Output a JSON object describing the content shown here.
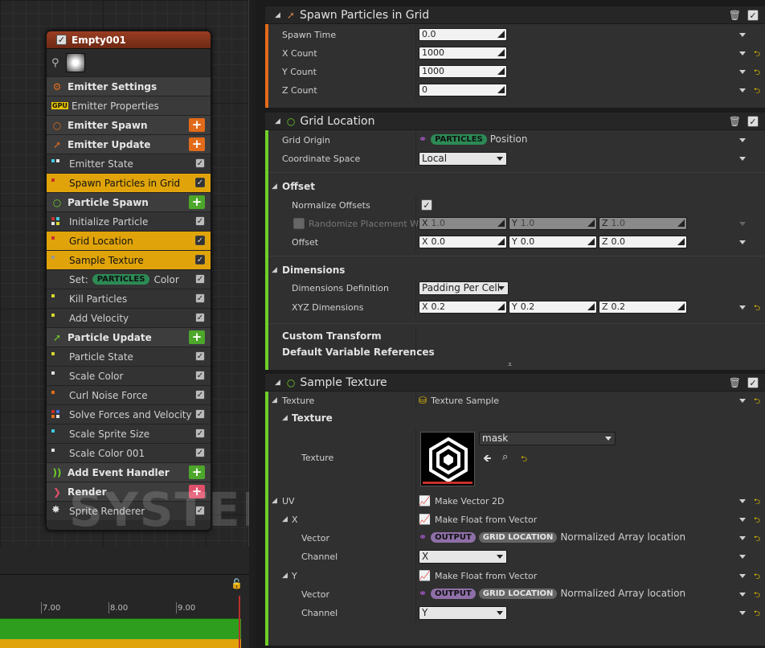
{
  "graph": {
    "watermark": "SYSTEM",
    "node": {
      "title": "Empty001",
      "rows": [
        {
          "kind": "hdr",
          "label": "Emitter Settings",
          "icon": "⚙",
          "icon_color": "#e26b1a",
          "icon_name": "emitter-settings-icon"
        },
        {
          "kind": "props",
          "label": "Emitter Properties",
          "icon": "GPU",
          "icon_name": "gpu-icon"
        },
        {
          "kind": "hdr",
          "label": "Emitter Spawn",
          "icon": "○",
          "icon_color": "#e26b1a",
          "icon_name": "emitter-spawn-icon",
          "plus": "o"
        },
        {
          "kind": "hdr",
          "label": "Emitter Update",
          "icon": "➚",
          "icon_color": "#e26b1a",
          "icon_name": "emitter-update-icon",
          "plus": "o"
        },
        {
          "kind": "mod",
          "label": "Emitter State",
          "dots": [
            "#3fc9e0",
            "#e0e0e0"
          ]
        },
        {
          "kind": "mod",
          "label": "Spawn Particles in Grid",
          "selected": true,
          "dots": [
            "#c8302a"
          ]
        },
        {
          "kind": "hdr",
          "label": "Particle Spawn",
          "icon": "○",
          "icon_color": "#6fcf2a",
          "icon_name": "particle-spawn-icon",
          "plus": "g"
        },
        {
          "kind": "mod",
          "label": "Initialize Particle",
          "dots": [
            "#c8302a",
            "#3fc9e0",
            "#e0e0e0",
            "#d6d630"
          ]
        },
        {
          "kind": "mod",
          "label": "Grid Location",
          "selected": true,
          "dots": [
            "#c8302a"
          ]
        },
        {
          "kind": "mod",
          "label": "Sample Texture",
          "selected": true,
          "dots": [
            "#999"
          ]
        },
        {
          "kind": "mod",
          "label": "Set:",
          "pill": "PARTICLES",
          "suffix": "Color",
          "dots": []
        },
        {
          "kind": "mod",
          "label": "Kill Particles",
          "dots": [
            "#d6d630"
          ]
        },
        {
          "kind": "mod",
          "label": "Add Velocity",
          "dots": [
            "#d6d630"
          ]
        },
        {
          "kind": "hdr",
          "label": "Particle Update",
          "icon": "➚",
          "icon_color": "#6fcf2a",
          "icon_name": "particle-update-icon",
          "plus": "g"
        },
        {
          "kind": "mod",
          "label": "Particle State",
          "dots": [
            "#d6d630"
          ]
        },
        {
          "kind": "mod",
          "label": "Scale Color",
          "dots": [
            "#e0e0e0"
          ]
        },
        {
          "kind": "mod",
          "label": "Curl Noise Force",
          "dots": [
            "#e26b1a"
          ]
        },
        {
          "kind": "mod",
          "label": "Solve Forces and Velocity",
          "dots": [
            "#c8302a",
            "#3f6fe0",
            "#e26b1a",
            "#e0e0e0"
          ]
        },
        {
          "kind": "mod",
          "label": "Scale Sprite Size",
          "dots": [
            "#3fc9e0"
          ]
        },
        {
          "kind": "mod",
          "label": "Scale Color 001",
          "dots": [
            "#e0e0e0"
          ]
        },
        {
          "kind": "hdr",
          "label": "Add Event Handler",
          "icon": "))",
          "icon_color": "#6fcf2a",
          "icon_name": "event-handler-icon",
          "plus": "g"
        },
        {
          "kind": "hdr",
          "label": "Render",
          "icon": "❯",
          "icon_color": "#e0506a",
          "icon_name": "render-icon",
          "plus": "r"
        },
        {
          "kind": "mod",
          "label": "Sprite Renderer",
          "dots": [],
          "star": true
        }
      ]
    },
    "timeline": {
      "ticks": [
        "7.00",
        "8.00",
        "9.00"
      ]
    }
  },
  "details": {
    "spawn_grid": {
      "title": "Spawn Particles in Grid",
      "rows": [
        {
          "label": "Spawn Time",
          "value": "0.0"
        },
        {
          "label": "X Count",
          "value": "1000"
        },
        {
          "label": "Y Count",
          "value": "1000"
        },
        {
          "label": "Z Count",
          "value": "0"
        }
      ]
    },
    "grid_location": {
      "title": "Grid Location",
      "grid_origin_label": "Grid Origin",
      "grid_origin_chip": "PARTICLES",
      "grid_origin_value": "Position",
      "coord_space_label": "Coordinate Space",
      "coord_space_value": "Local",
      "offset_cat": "Offset",
      "normalize_label": "Normalize Offsets",
      "randomize_label": "Randomize Placement Wi",
      "randomize_x": "1.0",
      "randomize_y": "1.0",
      "randomize_z": "1.0",
      "offset_label": "Offset",
      "offset_x": "0.0",
      "offset_y": "0.0",
      "offset_z": "0.0",
      "dimensions_cat": "Dimensions",
      "dim_def_label": "Dimensions Definition",
      "dim_def_value": "Padding Per Cell",
      "xyz_label": "XYZ Dimensions",
      "xyz_x": "0.2",
      "xyz_y": "0.2",
      "xyz_z": "0.2",
      "custom_transform": "Custom Transform",
      "default_refs": "Default Variable References"
    },
    "sample_texture": {
      "title": "Sample Texture",
      "texture_label": "Texture",
      "texture_value": "Texture Sample",
      "texture_cat": "Texture",
      "texture_prop_label": "Texture",
      "texture_asset": "mask",
      "uv_label": "UV",
      "uv_value": "Make Vector 2D",
      "x_label": "X",
      "x_value": "Make Float from Vector",
      "x_vector_label": "Vector",
      "x_vector_chip1": "OUTPUT",
      "x_vector_chip2": "GRID LOCATION",
      "x_vector_value": "Normalized Array location",
      "x_channel_label": "Channel",
      "x_channel_value": "X",
      "y_label": "Y",
      "y_value": "Make Float from Vector",
      "y_vector_label": "Vector",
      "y_vector_chip1": "OUTPUT",
      "y_vector_chip2": "GRID LOCATION",
      "y_vector_value": "Normalized Array location",
      "y_channel_label": "Channel",
      "y_channel_value": "Y"
    },
    "colors": {
      "spawn_strip": "#e26b1a",
      "grid_strip": "#6fcf2a",
      "sample_strip": "#6fcf2a"
    }
  }
}
